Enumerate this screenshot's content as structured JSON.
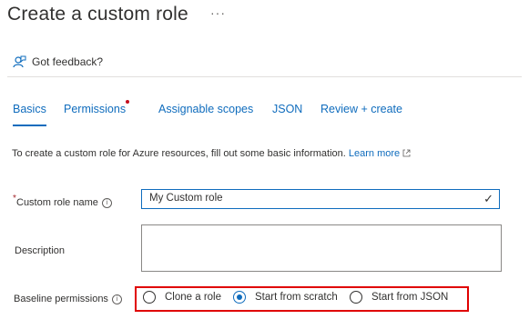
{
  "page": {
    "title": "Create a custom role",
    "more_label": "···",
    "feedback_label": "Got feedback?"
  },
  "tabs": [
    {
      "label": "Basics",
      "active": true
    },
    {
      "label": "Permissions",
      "required_dot": true
    },
    {
      "label": "Assignable scopes"
    },
    {
      "label": "JSON"
    },
    {
      "label": "Review + create"
    }
  ],
  "intro": {
    "text": "To create a custom role for Azure resources, fill out some basic information.",
    "link": "Learn more"
  },
  "form": {
    "name_label": "Custom role name",
    "name_required": "*",
    "name_value": "My Custom role",
    "description_label": "Description",
    "description_value": "",
    "baseline_label": "Baseline permissions",
    "baseline_options": [
      {
        "label": "Clone a role",
        "selected": false
      },
      {
        "label": "Start from scratch",
        "selected": true
      },
      {
        "label": "Start from JSON",
        "selected": false
      }
    ]
  },
  "colors": {
    "accent": "#0f6cbd",
    "highlight_box": "#e00000",
    "required": "#a4262c"
  },
  "icons": [
    "feedback-icon",
    "info-icon",
    "external-link-icon",
    "checkmark-icon",
    "ellipsis-icon"
  ]
}
